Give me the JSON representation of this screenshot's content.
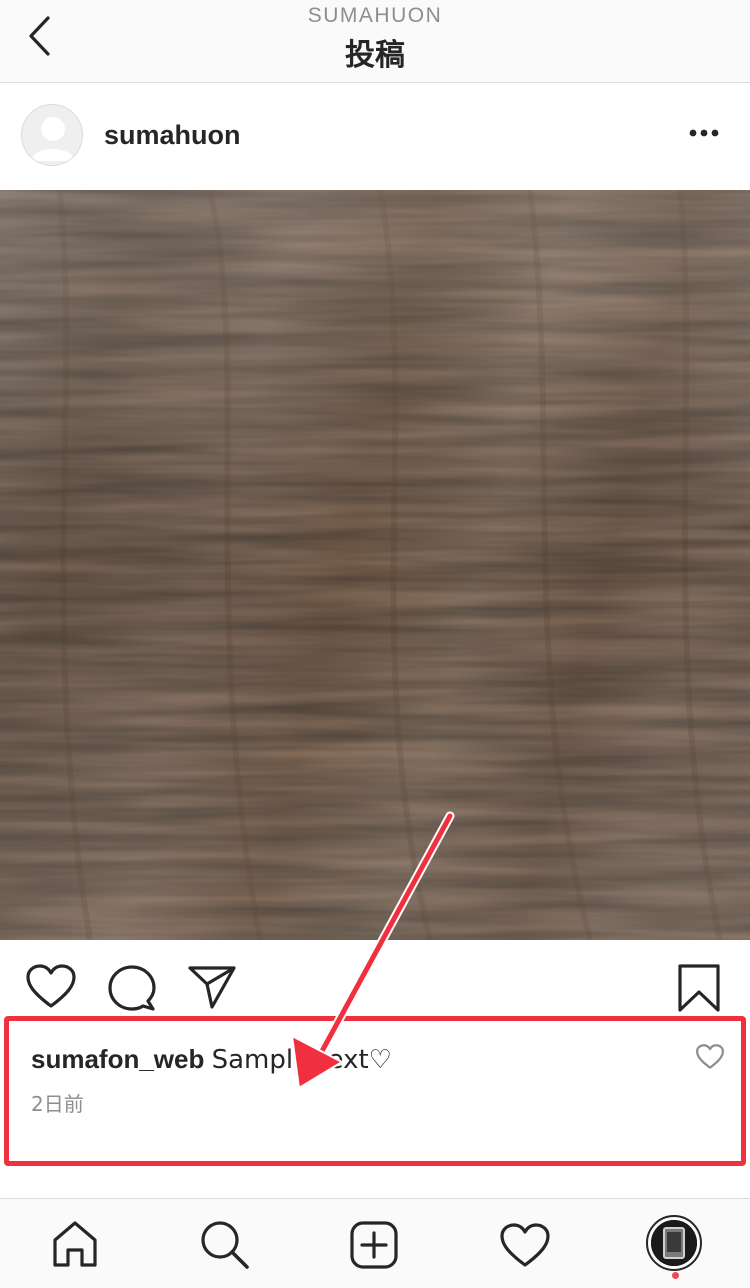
{
  "header": {
    "subtitle": "SUMAHUON",
    "title": "投稿"
  },
  "post": {
    "username": "sumahuon"
  },
  "comment": {
    "username": "sumafon_web",
    "text": "Sample text♡",
    "time": "2日前"
  },
  "colors": {
    "highlight": "#f0303f",
    "notification_dot": "#ed4956",
    "secondary_text": "#8e8e8e"
  },
  "icons": {
    "back": "chevron-left-icon",
    "more": "more-horizontal-icon",
    "like": "heart-icon",
    "comment": "comment-bubble-icon",
    "share": "paper-plane-icon",
    "save": "bookmark-icon",
    "home": "home-icon",
    "search": "search-icon",
    "new_post": "plus-square-icon",
    "activity": "heart-icon",
    "profile": "profile-avatar-icon"
  }
}
